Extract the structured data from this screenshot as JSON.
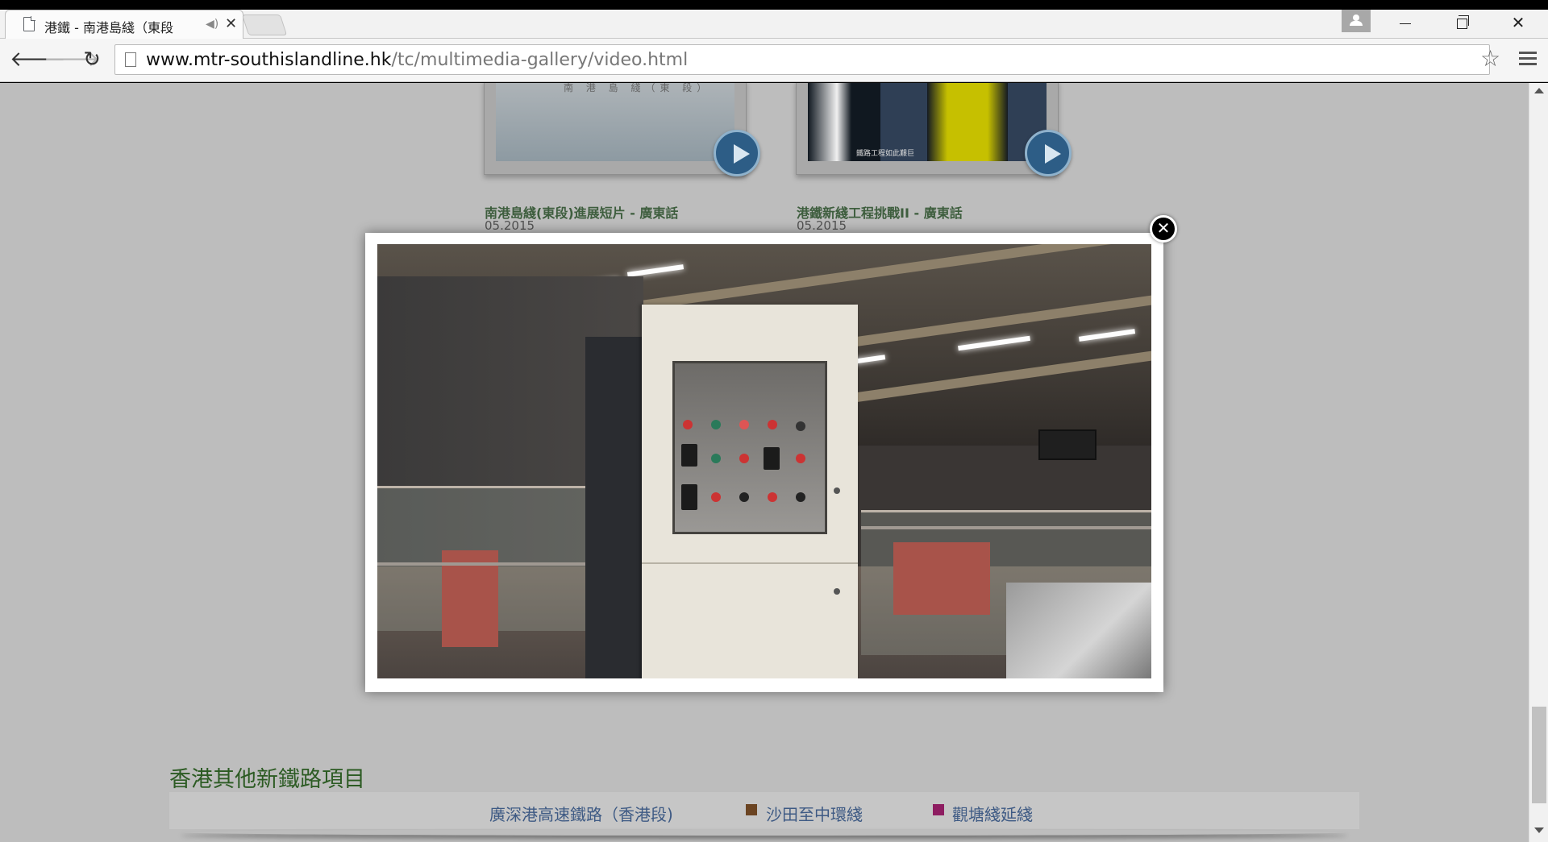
{
  "browser": {
    "tab_title": "港鐵 - 南港島綫（東段",
    "url_domain": "www.mtr-southislandline.hk",
    "url_path": "/tc/multimedia-gallery/video.html"
  },
  "icons": {
    "tab_favicon": "page-icon",
    "tab_audio": "speaker-icon",
    "tab_close": "close-icon",
    "back": "arrow-left-icon",
    "forward": "arrow-right-icon",
    "reload": "reload-icon",
    "bookmark": "star-icon",
    "menu": "hamburger-menu-icon",
    "modal_close": "close-circle-icon",
    "play": "play-icon"
  },
  "gallery": {
    "videos": [
      {
        "title": "南港島綫(東段)進展短片 - 廣東話",
        "date": "05.2015",
        "caption": "南 港 島 綫（東 段）"
      },
      {
        "title": "港鐵新綫工程挑戰II - 廣東話",
        "date": "05.2015",
        "caption": "鐵路工程如此艱巨"
      }
    ]
  },
  "other_projects": {
    "heading": "香港其他新鐵路項目",
    "links": [
      {
        "label": "廣深港高速鐵路（香港段)",
        "color": ""
      },
      {
        "label": "沙田至中環綫",
        "color": "#6b4422"
      },
      {
        "label": "觀塘綫延綫",
        "color": "#8e1d61"
      }
    ]
  },
  "colors": {
    "heading": "#2c5b23",
    "link": "#3e5a84",
    "overlay": "#bdbdbd"
  }
}
